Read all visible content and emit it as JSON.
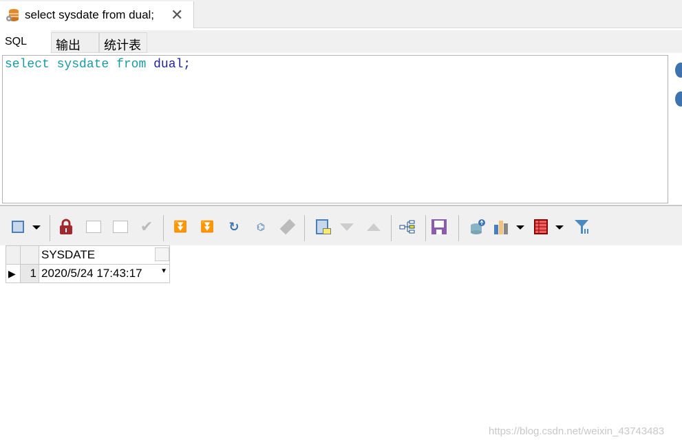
{
  "doc_tab": {
    "title": "select sysdate from dual;",
    "icon": "database-gear-icon",
    "close": "✕"
  },
  "subtabs": [
    {
      "label": "SQL",
      "active": true
    },
    {
      "label": "输出"
    },
    {
      "label": "统计表"
    }
  ],
  "editor": {
    "tokens": [
      {
        "text": "select",
        "cls": "kw"
      },
      {
        "text": "sysdate",
        "cls": "kw"
      },
      {
        "text": "from",
        "cls": "kw"
      },
      {
        "text": "dual;",
        "cls": "id"
      }
    ]
  },
  "grid": {
    "columns": [
      "SYSDATE"
    ],
    "rows": [
      {
        "num": "1",
        "values": [
          "2020/5/24 17:43:17"
        ]
      }
    ]
  },
  "colors": {
    "keyword": "#1a9aa0",
    "identifier": "#222299",
    "lock": "#a3282e",
    "save": "#8b5bb0"
  },
  "watermark": "https://blog.csdn.net/weixin_43743483"
}
